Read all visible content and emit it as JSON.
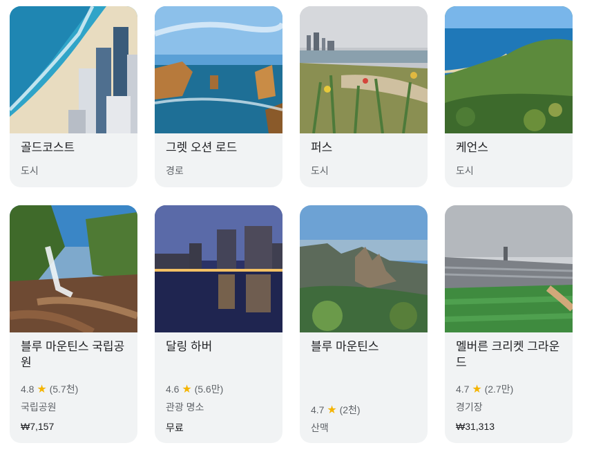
{
  "cards": [
    {
      "title": "골드코스트",
      "category": "도시"
    },
    {
      "title": "그렛 오션 로드",
      "category": "경로"
    },
    {
      "title": "퍼스",
      "category": "도시"
    },
    {
      "title": "케언스",
      "category": "도시"
    },
    {
      "title": "블루 마운틴스 국립공원",
      "rating": "4.8",
      "reviews": "(5.7천)",
      "category": "국립공원",
      "price": "₩7,157"
    },
    {
      "title": "달링 하버",
      "rating": "4.6",
      "reviews": "(5.6만)",
      "category": "관광 명소",
      "price": "무료"
    },
    {
      "title": "블루 마운틴스",
      "rating": "4.7",
      "reviews": "(2천)",
      "category": "산맥"
    },
    {
      "title": "멜버른 크리켓 그라운드",
      "rating": "4.7",
      "reviews": "(2.7만)",
      "category": "경기장",
      "price": "₩31,313"
    }
  ],
  "star_icon": "★",
  "colors": {
    "card_bg": "#f1f3f4",
    "star": "#f4b400",
    "muted_text": "#5f6368"
  }
}
